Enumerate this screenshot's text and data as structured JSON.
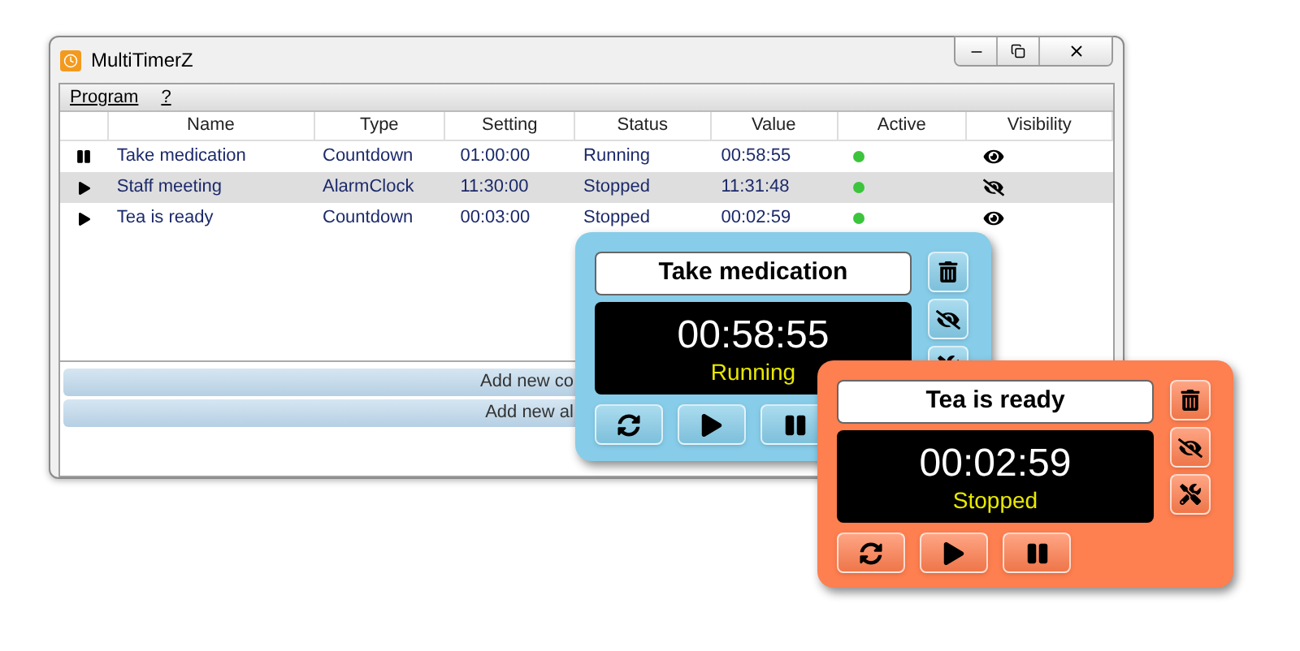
{
  "window": {
    "title": "MultiTimerZ"
  },
  "menu": [
    "Program",
    "?"
  ],
  "table": {
    "columns": [
      "Name",
      "Type",
      "Setting",
      "Status",
      "Value",
      "Active",
      "Visibility"
    ],
    "rows": [
      {
        "kind": "pause",
        "name": "Take medication",
        "type": "Countdown",
        "setting": "01:00:00",
        "status": "Running",
        "value": "00:58:55",
        "active": true,
        "visible": true,
        "selected": false
      },
      {
        "kind": "play",
        "name": "Staff meeting",
        "type": "AlarmClock",
        "setting": "11:30:00",
        "status": "Stopped",
        "value": "11:31:48",
        "active": true,
        "visible": false,
        "selected": true
      },
      {
        "kind": "play",
        "name": "Tea is ready",
        "type": "Countdown",
        "setting": "00:03:00",
        "status": "Stopped",
        "value": "00:02:59",
        "active": true,
        "visible": true,
        "selected": false
      }
    ]
  },
  "buttons": [
    "Add new co",
    "Add new al"
  ],
  "widgets": [
    {
      "name": "Take medication",
      "time": "00:58:55",
      "status": "Running",
      "color": "#87cde9"
    },
    {
      "name": "Tea is ready",
      "time": "00:02:59",
      "status": "Stopped",
      "color": "#fe7f50"
    }
  ]
}
